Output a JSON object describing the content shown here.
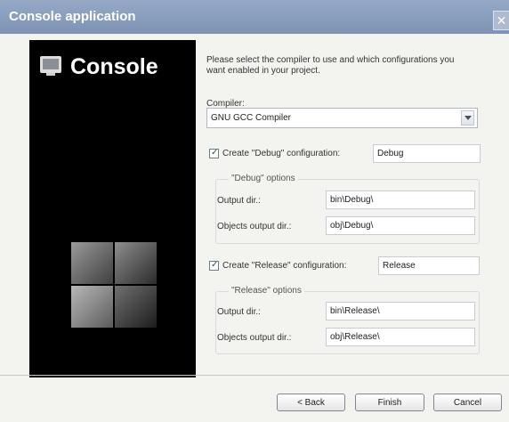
{
  "window": {
    "title": "Console application",
    "close_glyph": "✕"
  },
  "left_panel": {
    "logo_text": "Console"
  },
  "instructions": "Please select the compiler to use and which configurations you want enabled in your project.",
  "compiler": {
    "label": "Compiler:",
    "selected": "GNU GCC Compiler"
  },
  "debug": {
    "checkbox_label": "Create \"Debug\" configuration:",
    "config_name": "Debug",
    "group_title": "\"Debug\" options",
    "output_label": "Output dir.:",
    "output_value": "bin\\Debug\\",
    "objects_label": "Objects output dir.:",
    "objects_value": "obj\\Debug\\"
  },
  "release": {
    "checkbox_label": "Create \"Release\" configuration:",
    "config_name": "Release",
    "group_title": "\"Release\" options",
    "output_label": "Output dir.:",
    "output_value": "bin\\Release\\",
    "objects_label": "Objects output dir.:",
    "objects_value": "obj\\Release\\"
  },
  "buttons": {
    "back": "< Back",
    "finish": "Finish",
    "cancel": "Cancel"
  },
  "icons": {
    "logo": "console-logo-icon",
    "checkbox": "checkmark-icon",
    "dropdown": "chevron-down-icon"
  },
  "colors": {
    "titlebar": "#8599b8",
    "panel": "#000000",
    "window_bg": "#f3f3ef"
  }
}
